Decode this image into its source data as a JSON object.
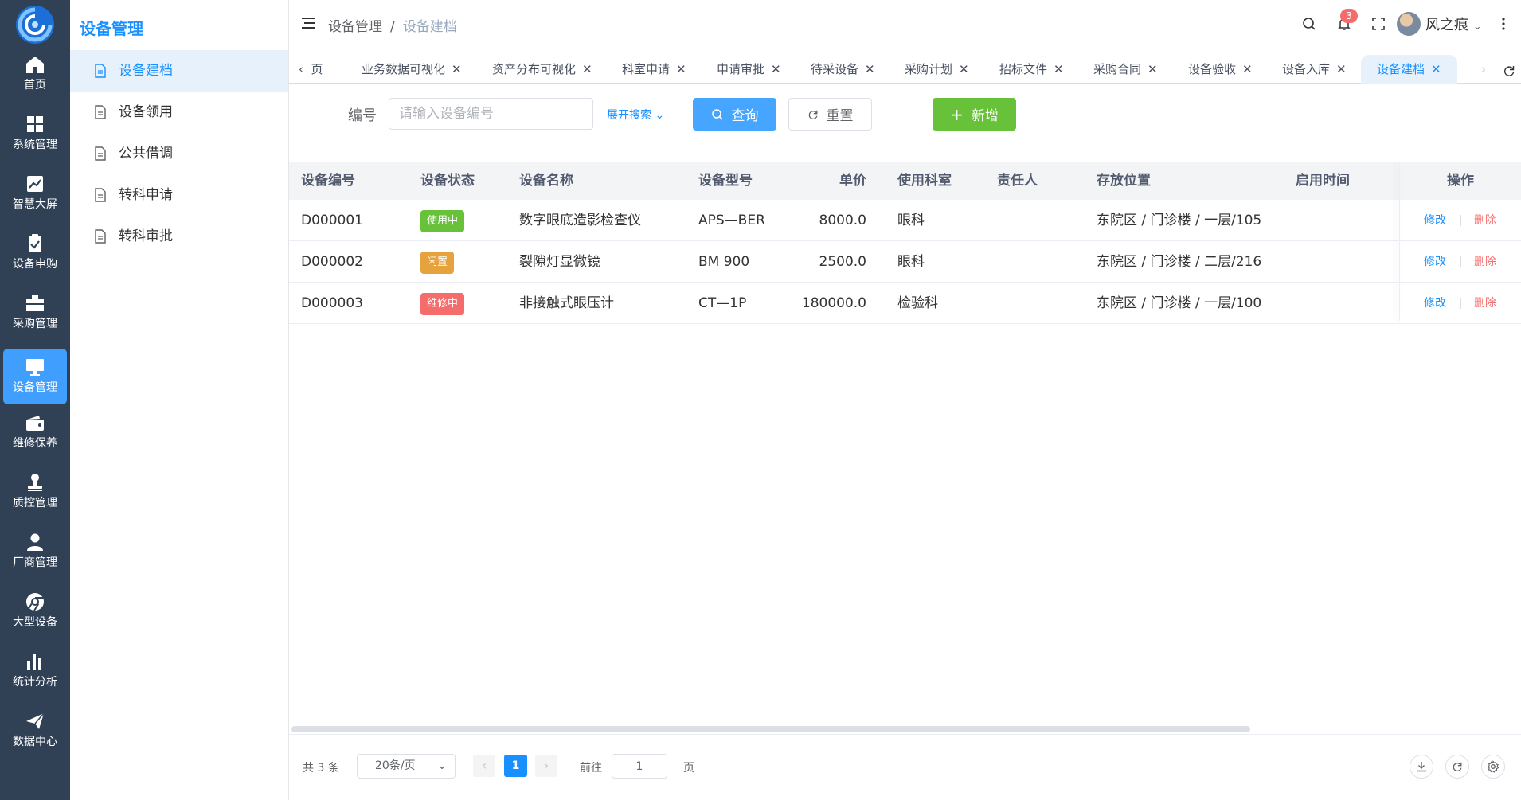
{
  "iconbar": {
    "items": [
      {
        "label": "首页",
        "icon": "home-icon"
      },
      {
        "label": "系统管理",
        "icon": "grid-icon"
      },
      {
        "label": "智慧大屏",
        "icon": "chart-line-icon"
      },
      {
        "label": "设备申购",
        "icon": "checklist-icon"
      },
      {
        "label": "采购管理",
        "icon": "toolbox-icon"
      },
      {
        "label": "设备管理",
        "icon": "monitor-icon"
      },
      {
        "label": "维修保养",
        "icon": "wallet-icon"
      },
      {
        "label": "质控管理",
        "icon": "stamp-icon"
      },
      {
        "label": "厂商管理",
        "icon": "user-icon"
      },
      {
        "label": "大型设备",
        "icon": "chrome-icon"
      },
      {
        "label": "统计分析",
        "icon": "bar-chart-icon"
      },
      {
        "label": "数据中心",
        "icon": "paper-plane-icon"
      }
    ]
  },
  "submenu": {
    "title": "设备管理",
    "items": [
      {
        "label": "设备建档"
      },
      {
        "label": "设备领用"
      },
      {
        "label": "公共借调"
      },
      {
        "label": "转科申请"
      },
      {
        "label": "转科审批"
      }
    ]
  },
  "header": {
    "breadcrumb": [
      "设备管理",
      "设备建档"
    ],
    "notification_count": "3",
    "username": "风之痕"
  },
  "tabs": {
    "partial_first": "页",
    "items": [
      "业务数据可视化",
      "资产分布可视化",
      "科室申请",
      "申请审批",
      "待采设备",
      "采购计划",
      "招标文件",
      "采购合同",
      "设备验收",
      "设备入库",
      "设备建档"
    ]
  },
  "search": {
    "label": "编号",
    "placeholder": "请输入设备编号",
    "expand_label": "展开搜索",
    "query_label": "查询",
    "reset_label": "重置",
    "add_label": "新增"
  },
  "table": {
    "columns": [
      "设备编号",
      "设备状态",
      "设备名称",
      "设备型号",
      "单价",
      "使用科室",
      "责任人",
      "存放位置",
      "启用时间",
      "操作"
    ],
    "rows": [
      {
        "code": "D000001",
        "status": "使用中",
        "status_color": "#67c23a",
        "name": "数字眼底造影检查仪",
        "model": "APS—BER",
        "price": "8000.0",
        "dept": "眼科",
        "owner": "",
        "location": "东院区 / 门诊楼 / 一层/105",
        "start": ""
      },
      {
        "code": "D000002",
        "status": "闲置",
        "status_color": "#e6a23c",
        "name": "裂隙灯显微镜",
        "model": "BM 900",
        "price": "2500.0",
        "dept": "眼科",
        "owner": "",
        "location": "东院区 / 门诊楼 / 二层/216",
        "start": ""
      },
      {
        "code": "D000003",
        "status": "维修中",
        "status_color": "#f56c6c",
        "name": "非接触式眼压计",
        "model": "CT—1P",
        "price": "180000.0",
        "dept": "检验科",
        "owner": "",
        "location": "东院区 / 门诊楼 / 一层/100",
        "start": ""
      }
    ],
    "edit_label": "修改",
    "delete_label": "删除"
  },
  "pagination": {
    "total": "共 3 条",
    "page_size": "20条/页",
    "current_page": "1",
    "goto_label": "前往",
    "goto_value": "1",
    "page_suffix": "页"
  }
}
